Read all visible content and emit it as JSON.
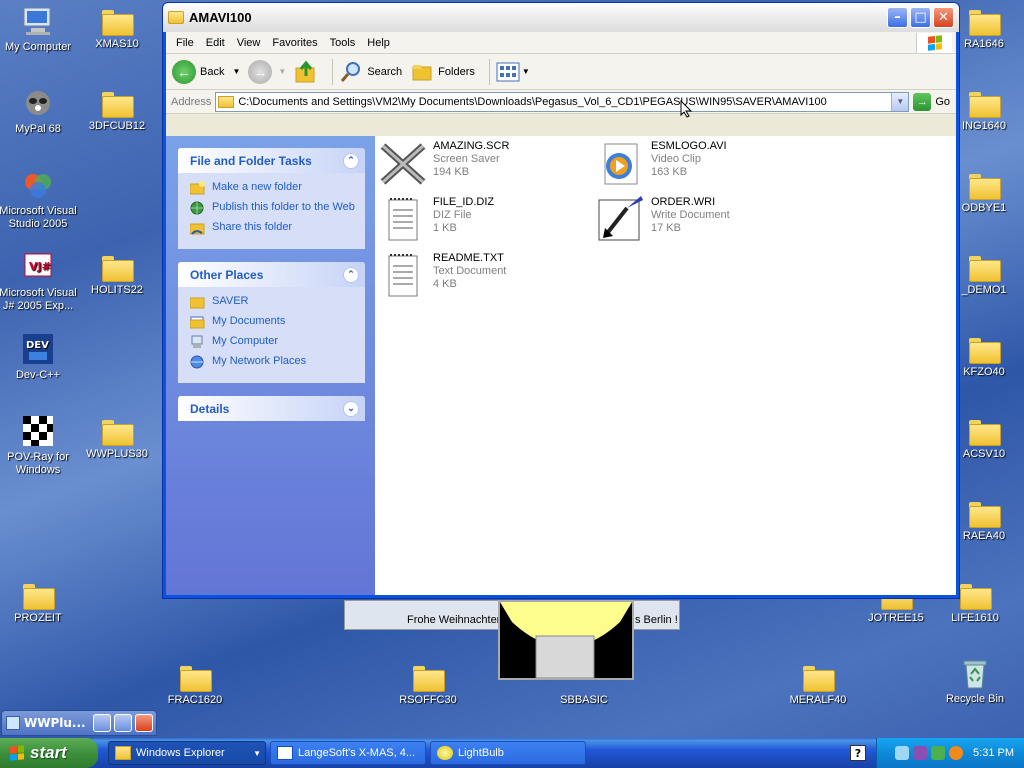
{
  "desktop": {
    "icons_left": [
      {
        "label": "My Computer"
      },
      {
        "label": "XMAS10"
      },
      {
        "label": "MyPal 68"
      },
      {
        "label": "3DFCUB12"
      },
      {
        "label": "Microsoft Visual Studio 2005"
      },
      {
        "label": "Microsoft Visual J# 2005 Exp..."
      },
      {
        "label": "HOLITS22"
      },
      {
        "label": "Dev-C++"
      },
      {
        "label": "POV-Ray for Windows"
      },
      {
        "label": "WWPLUS30"
      },
      {
        "label": "PROZEIT"
      }
    ],
    "icons_right": [
      {
        "label": "RA1646"
      },
      {
        "label": "ING1640"
      },
      {
        "label": "ODBYE1"
      },
      {
        "label": "_DEMO1"
      },
      {
        "label": "KFZO40"
      },
      {
        "label": "ACSV10"
      },
      {
        "label": "RAEA40"
      },
      {
        "label": "JOTREE15"
      },
      {
        "label": "LIFE1610"
      },
      {
        "label": "Recycle Bin"
      }
    ],
    "icons_bottom": [
      {
        "label": "FRAC1620"
      },
      {
        "label": "RSOFFC30"
      },
      {
        "label": "SBBASIC"
      },
      {
        "label": "MERALF40"
      }
    ],
    "xmas_card_left": "Frohe Weihnachten",
    "xmas_card_right": "s Berlin !"
  },
  "window": {
    "title": "AMAVI100",
    "menu": [
      "File",
      "Edit",
      "View",
      "Favorites",
      "Tools",
      "Help"
    ],
    "toolbar": {
      "back": "Back",
      "search": "Search",
      "folders": "Folders"
    },
    "address": {
      "label": "Address",
      "value": "C:\\Documents and Settings\\VM2\\My Documents\\Downloads\\Pegasus_Vol_6_CD1\\PEGASUS\\WIN95\\SAVER\\AMAVI100",
      "go": "Go"
    },
    "tasks_panel": {
      "title": "File and Folder Tasks",
      "items": [
        {
          "label": "Make a new folder"
        },
        {
          "label": "Publish this folder to the Web"
        },
        {
          "label": "Share this folder"
        }
      ]
    },
    "places_panel": {
      "title": "Other Places",
      "items": [
        {
          "label": "SAVER"
        },
        {
          "label": "My Documents"
        },
        {
          "label": "My Computer"
        },
        {
          "label": "My Network Places"
        }
      ]
    },
    "details_panel": {
      "title": "Details"
    },
    "files": [
      {
        "name": "AMAZING.SCR",
        "type": "Screen Saver",
        "size": "194 KB",
        "icon": "screensaver-icon"
      },
      {
        "name": "ESMLOGO.AVI",
        "type": "Video Clip",
        "size": "163 KB",
        "icon": "video-icon"
      },
      {
        "name": "FILE_ID.DIZ",
        "type": "DIZ File",
        "size": "1 KB",
        "icon": "text-file-icon"
      },
      {
        "name": "ORDER.WRI",
        "type": "Write Document",
        "size": "17 KB",
        "icon": "write-doc-icon"
      },
      {
        "name": "README.TXT",
        "type": "Text Document",
        "size": "4 KB",
        "icon": "text-file-icon"
      }
    ]
  },
  "minimized_window": {
    "title": "WWPlu..."
  },
  "taskbar": {
    "start": "start",
    "tasks": [
      {
        "label": "Windows Explorer"
      },
      {
        "label": "LangeSoft's X-MAS, 4..."
      },
      {
        "label": "LightBulb"
      }
    ],
    "clock": "5:31 PM"
  }
}
